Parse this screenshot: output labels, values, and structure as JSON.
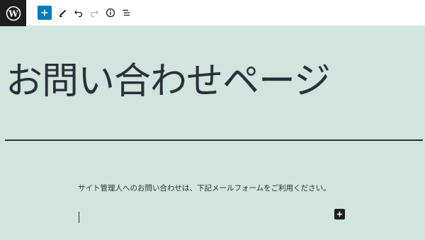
{
  "colors": {
    "background": "#d1e4dd",
    "text": "#28303d",
    "toolbar_bg": "#ffffff",
    "logo_bg": "#1e1e1e",
    "accent": "#007cba"
  },
  "toolbar": {
    "icons": [
      "wordpress-logo",
      "add-block-icon",
      "pencil-icon",
      "undo-icon",
      "redo-icon",
      "info-icon",
      "list-view-icon"
    ]
  },
  "post": {
    "title": "お問い合わせページ",
    "paragraph": "サイト管理人へのお問い合わせは、下記メールフォームをご利用ください。"
  }
}
